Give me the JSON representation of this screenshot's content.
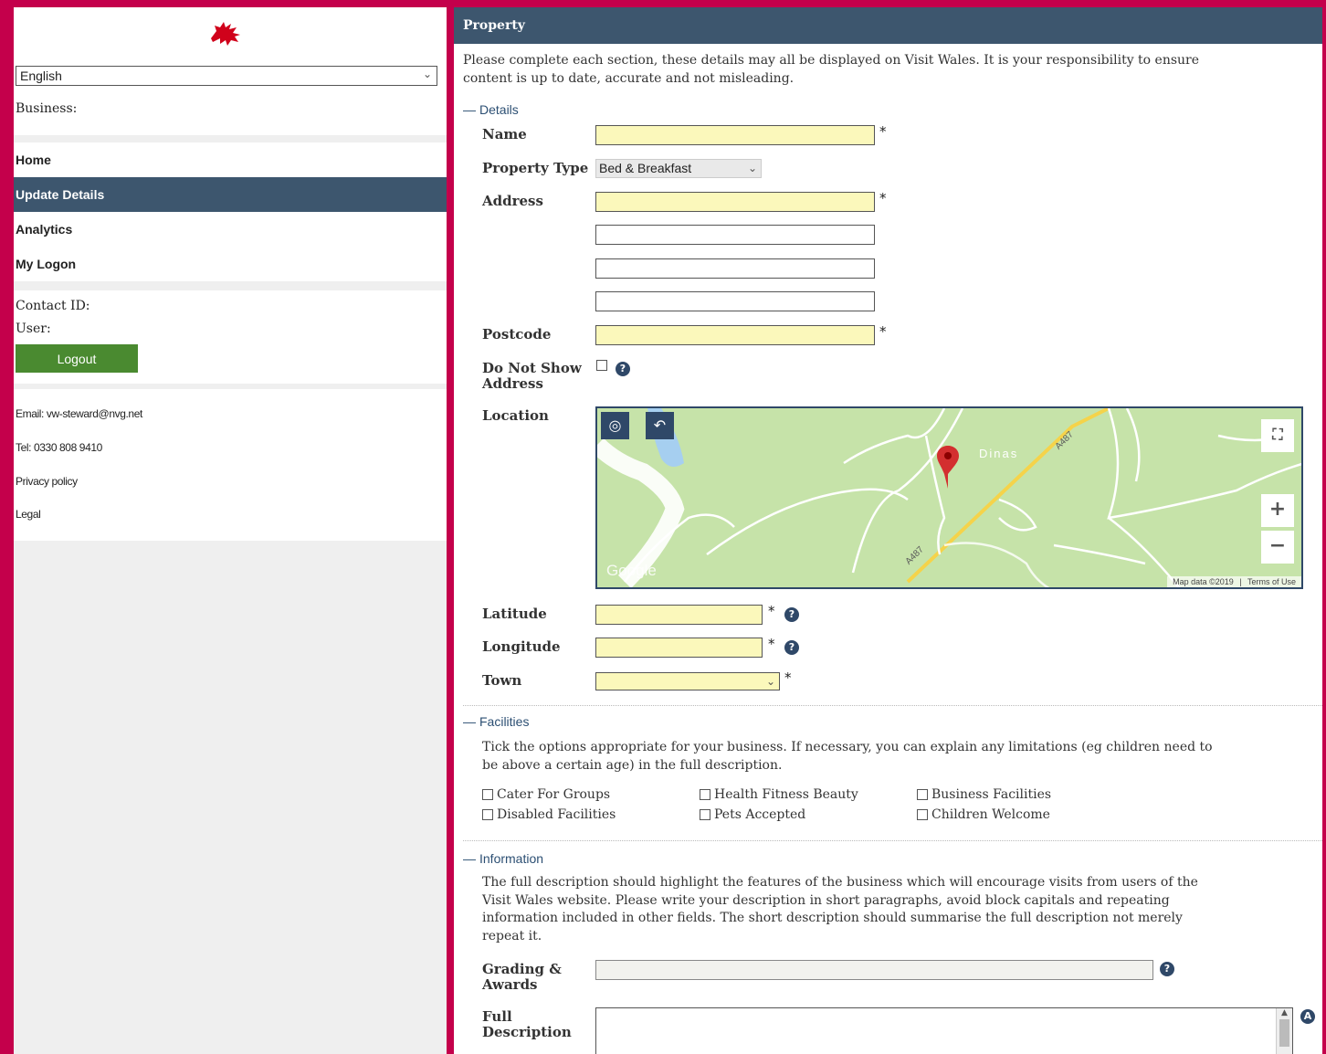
{
  "sidebar": {
    "language": "English",
    "business_label": "Business:",
    "nav": [
      "Home",
      "Update Details",
      "Analytics",
      "My Logon"
    ],
    "contact_id_label": "Contact ID:",
    "user_label": "User:",
    "logout_label": "Logout",
    "email": "Email: vw-steward@nvg.net",
    "tel": "Tel: 0330 808 9410",
    "privacy": "Privacy policy",
    "legal": "Legal"
  },
  "main": {
    "header": "Property",
    "intro_line1": "Please complete each section, these details may all be displayed on Visit Wales. It is your responsibility to ensure",
    "intro_line2": "content is up to date, accurate and not misleading.",
    "details": {
      "title": "Details",
      "name_label": "Name",
      "property_type_label": "Property Type",
      "property_type_value": "Bed & Breakfast",
      "address_label": "Address",
      "postcode_label": "Postcode",
      "do_not_show_label_1": "Do Not Show",
      "do_not_show_label_2": "Address",
      "location_label": "Location",
      "latitude_label": "Latitude",
      "longitude_label": "Longitude",
      "town_label": "Town",
      "required_mark": "*"
    },
    "map": {
      "place_label": "Dinas",
      "road_label_1": "A487",
      "road_label_2": "A487",
      "google": "Google",
      "attribution": "Map data ©2019",
      "terms": "Terms of Use"
    },
    "facilities": {
      "title": "Facilities",
      "help_line1": "Tick the options appropriate for your business. If necessary, you can explain any limitations (eg children need to",
      "help_line2": "be above a certain age) in the full description.",
      "options": [
        "Cater For Groups",
        "Health Fitness Beauty",
        "Business Facilities",
        "Disabled Facilities",
        "Pets Accepted",
        "Children Welcome"
      ]
    },
    "information": {
      "title": "Information",
      "help_line1": "The full description should highlight the features of the business which will encourage visits from users of the",
      "help_line2": "Visit Wales website. Please write your description in short paragraphs, avoid block capitals and repeating",
      "help_line3": "information included in other fields. The short description should summarise the full description not merely",
      "help_line4": "repeat it.",
      "grading_label_1": "Grading &",
      "grading_label_2": "Awards",
      "full_desc_label_1": "Full",
      "full_desc_label_2": "Description"
    }
  },
  "colors": {
    "frame": "#c4004b",
    "header": "#3d566e",
    "logout": "#4a8a30",
    "required_field": "#fbf8bb"
  }
}
